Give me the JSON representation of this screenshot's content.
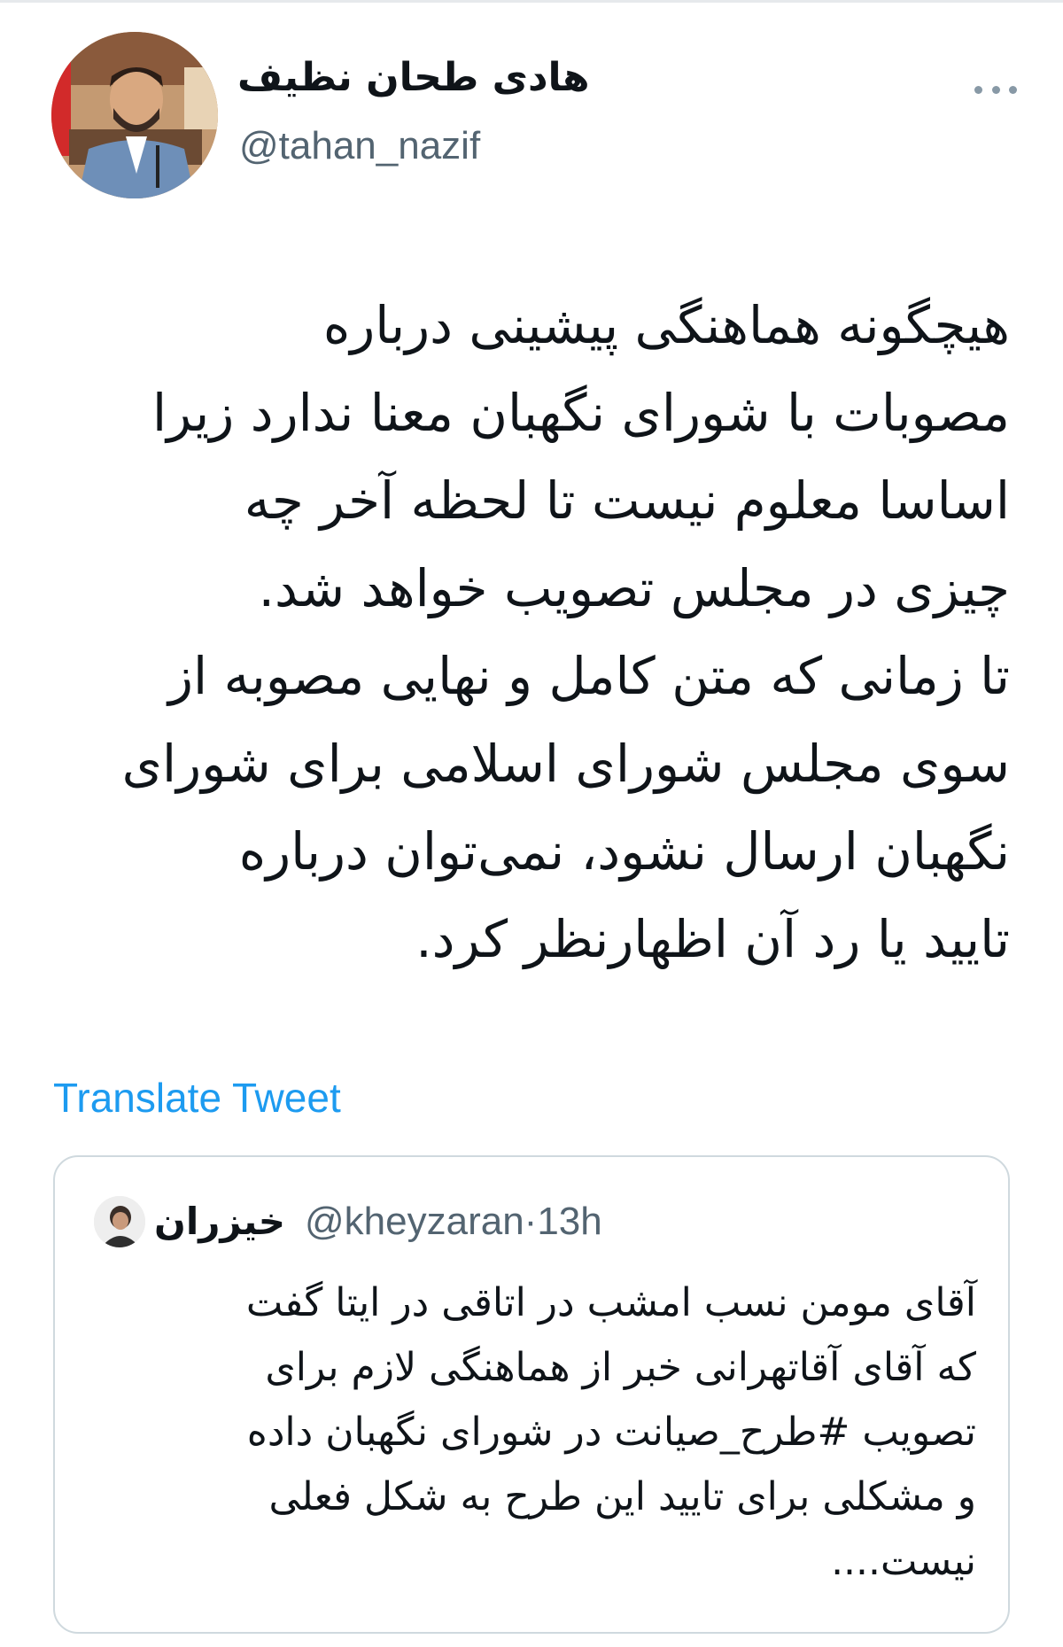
{
  "author": {
    "display_name": "هادی طحان نظیف",
    "handle": "@tahan_nazif"
  },
  "tweet": {
    "lines": [
      "هیچگونه هماهنگی پیشینی درباره",
      "مصوبات با شورای نگهبان معنا ندارد زیرا",
      "اساسا معلوم نیست تا لحظه آخر چه",
      "چیزی در مجلس تصویب خواهد شد.",
      "تا زمانی که متن کامل و نهایی مصوبه از",
      "سوی مجلس شورای اسلامی برای شورای",
      "نگهبان ارسال نشود، نمی‌توان درباره",
      "تایید یا رد آن اظهارنظر کرد."
    ],
    "translate_label": "Translate Tweet"
  },
  "quoted_tweet": {
    "display_name": "خیزران",
    "handle": "@kheyzaran",
    "separator": "·",
    "time": "13h",
    "lines": [
      "آقای مومن نسب امشب در اتاقی در ایتا گفت",
      "که آقای آقاتهرانی خبر از هماهنگی لازم برای",
      "تصویب #طرح_صیانت در شورای نگهبان داده",
      "و مشکلی برای تایید این طرح به شکل فعلی",
      "نیست...."
    ]
  },
  "icons": {
    "more": "more-horizontal-icon"
  },
  "colors": {
    "link": "#1d9bf0",
    "secondary_text": "#536471",
    "border": "#cfd9de"
  }
}
